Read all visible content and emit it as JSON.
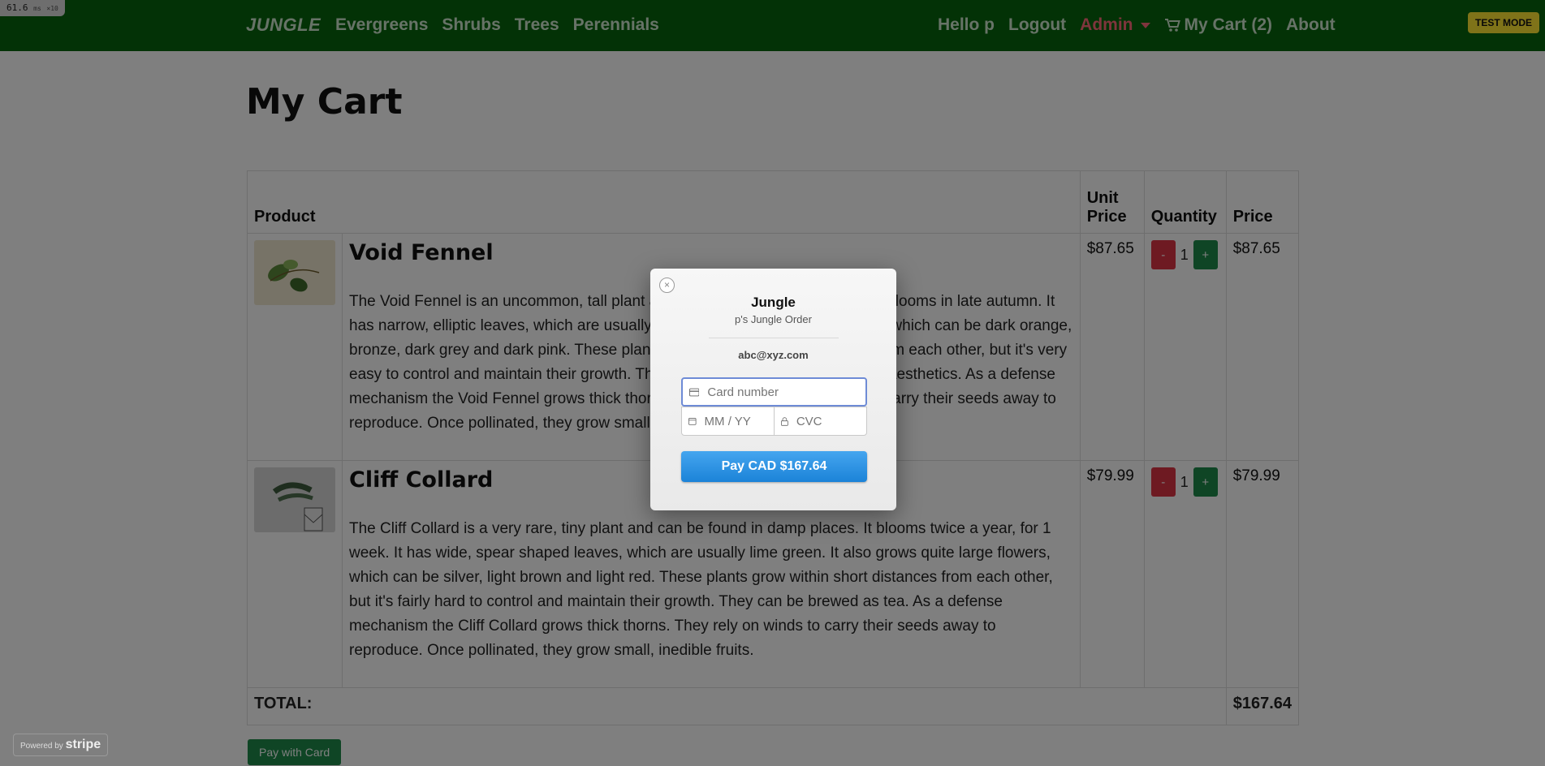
{
  "perf": {
    "value": "61.6",
    "unit": "ms",
    "scale": "×10"
  },
  "nav": {
    "brand": "JUNGLE",
    "left": [
      "Evergreens",
      "Shrubs",
      "Trees",
      "Perennials"
    ],
    "greeting": "Hello p",
    "logout": "Logout",
    "admin": "Admin",
    "cart": "My Cart (2)",
    "about": "About"
  },
  "test_mode": "TEST MODE",
  "page_title": "My Cart",
  "table": {
    "headers": {
      "product": "Product",
      "unit_price": "Unit Price",
      "quantity": "Quantity",
      "price": "Price"
    },
    "rows": [
      {
        "name": "Void Fennel",
        "description": "The Void Fennel is an uncommon, tall plant and can be found in dry regions. It blooms in late autumn. It has narrow, elliptic leaves, which are usually green. It also grows large flowers, which can be dark orange, bronze, dark grey and dark pink. These plants grow within a decent distance from each other, but it's very easy to control and maintain their growth. They have no real use, besides their aesthetics. As a defense mechanism the Void Fennel grows thick thorns. They rely on water currents to carry their seeds away to reproduce. Once pollinated, they grow small, inedible fruits.",
        "unit_price": "$87.65",
        "quantity": "1",
        "price": "$87.65"
      },
      {
        "name": "Cliff Collard",
        "description": "The Cliff Collard is a very rare, tiny plant and can be found in damp places. It blooms twice a year, for 1 week. It has wide, spear shaped leaves, which are usually lime green. It also grows quite large flowers, which can be silver, light brown and light red. These plants grow within short distances from each other, but it's fairly hard to control and maintain their growth. They can be brewed as tea. As a defense mechanism the Cliff Collard grows thick thorns. They rely on winds to carry their seeds away to reproduce. Once pollinated, they grow small, inedible fruits.",
        "unit_price": "$79.99",
        "quantity": "1",
        "price": "$79.99"
      }
    ],
    "minus_label": "-",
    "plus_label": "+",
    "total_label": "TOTAL:",
    "total_value": "$167.64"
  },
  "pay_with_card": "Pay with Card",
  "powered_by": {
    "prefix": "Powered by",
    "brand": "stripe"
  },
  "modal": {
    "close": "×",
    "title": "Jungle",
    "subtitle": "p's Jungle Order",
    "email": "abc@xyz.com",
    "card_placeholder": "Card number",
    "expiry_placeholder": "MM / YY",
    "cvc_placeholder": "CVC",
    "pay_button": "Pay CAD $167.64"
  },
  "colors": {
    "navbar": "#06640c",
    "admin": "#ff6b7a",
    "pay_button": "#2f95e6",
    "minus": "#dc3545",
    "plus": "#1f8a4a"
  }
}
